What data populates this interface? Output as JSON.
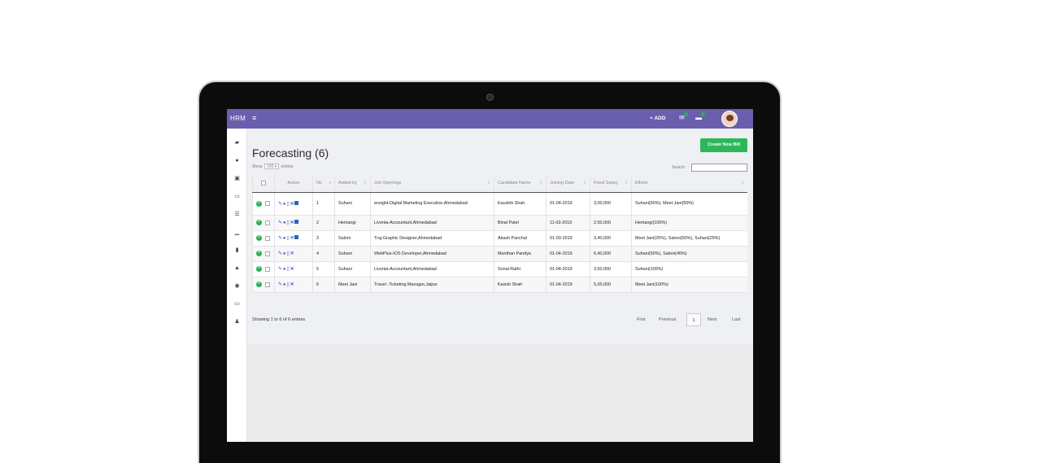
{
  "app": {
    "brand": "HRM"
  },
  "topbar": {
    "menu_icon": "hamburger-icon",
    "add_label": "+ ADD",
    "icons": [
      "mail-icon",
      "message-icon"
    ]
  },
  "sidebar": {
    "icons": [
      "folder-icon",
      "user-icon",
      "document-icon",
      "card-icon",
      "list-icon",
      "bar-chart-icon",
      "file-icon",
      "graduation-cap-icon",
      "eye-icon",
      "id-card-icon",
      "person-icon"
    ]
  },
  "page": {
    "title": "Forecasting (6)",
    "create_button": "Create New Bill",
    "show_label": "Show",
    "entries_value": "100 ▾",
    "entries_label": "entries",
    "search_label": "Search:",
    "search_value": ""
  },
  "table": {
    "headers": [
      "",
      "Action",
      "No",
      "Added by",
      "Job Openings",
      "Candidate Name",
      "Joining Date",
      "Fixed Salary",
      "Efforts"
    ],
    "rows": [
      {
        "no": "1",
        "added_by": "Suhani",
        "job": "ensight-Digital Marketing Executive,Ahmedabad",
        "candidate": "Kaushik Shah",
        "joining": "01-04-2019",
        "salary": "3,00,000",
        "efforts": "Suhani(50%), Meet Jani(50%)"
      },
      {
        "no": "2",
        "added_by": "Hemangi",
        "job": "Livonta-Accountant,Ahmedabad",
        "candidate": "Binal Patel",
        "joining": "11-03-2019",
        "salary": "2,50,000",
        "efforts": "Hemangi(100%)"
      },
      {
        "no": "3",
        "added_by": "Saloni",
        "job": "Traj-Graphic Designer,Ahmedabad",
        "candidate": "Akash Panchal",
        "joining": "01-03-2019",
        "salary": "3,40,000",
        "efforts": "Meet Jani(25%), Saloni(50%), Suhani(25%)"
      },
      {
        "no": "4",
        "added_by": "Suhani",
        "job": "WebPlus-IOS Developer,Ahmedabad",
        "candidate": "Manthan Pandya",
        "joining": "01-04-2019",
        "salary": "6,40,000",
        "efforts": "Suhani(50%), Saloni(46%)"
      },
      {
        "no": "5",
        "added_by": "Suhani",
        "job": "Livonta-Accountant,Ahmedabad",
        "candidate": "Sonal Rathi",
        "joining": "01-04-2019",
        "salary": "3,50,000",
        "efforts": "Suhani(100%)"
      },
      {
        "no": "6",
        "added_by": "Meet Jani",
        "job": "Travel -Ticketing Manager,Jaipur",
        "candidate": "Kavish Shah",
        "joining": "01-04-2019",
        "salary": "5,00,000",
        "efforts": "Meet Jani(100%)"
      }
    ]
  },
  "footer": {
    "info": "Showing 1 to 6 of 6 entries",
    "first": "First",
    "previous": "Previous",
    "page": "1",
    "next": "Next",
    "last": "Last"
  },
  "colors": {
    "topbar": "#6a5fae",
    "create_button": "#2eb65a",
    "action_icons": "#2f63b5"
  }
}
